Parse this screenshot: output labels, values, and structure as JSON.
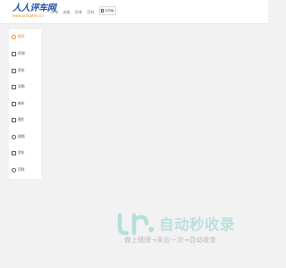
{
  "header": {
    "logo_title": "人人评车网",
    "logo_url": "www.autopten.cn",
    "nav": [
      "评车",
      "选车",
      "用车",
      "百科"
    ],
    "mobile_label": "手机版"
  },
  "sidebar": {
    "items": [
      {
        "label": "推荐",
        "icon": "home-icon",
        "active": true
      },
      {
        "label": "评测",
        "icon": "document-icon",
        "active": false
      },
      {
        "label": "资讯",
        "icon": "news-icon",
        "active": false
      },
      {
        "label": "导购",
        "icon": "guide-icon",
        "active": false
      },
      {
        "label": "新车",
        "icon": "new-car-icon",
        "active": false
      },
      {
        "label": "图片",
        "icon": "picture-icon",
        "active": false
      },
      {
        "label": "视频",
        "icon": "video-icon",
        "active": false
      },
      {
        "label": "用车",
        "icon": "car-icon",
        "active": false
      },
      {
        "label": "百科",
        "icon": "encyclopedia-icon",
        "active": false
      }
    ]
  },
  "watermark": {
    "title": "自动秒收录",
    "subtitle": "做上链接→来访一次→自动收录",
    "accent_color": "#7dd3cb"
  },
  "colors": {
    "brand_blue": "#1e4ea8",
    "accent_orange": "#f08a1c",
    "background": "#f2f2f2"
  }
}
